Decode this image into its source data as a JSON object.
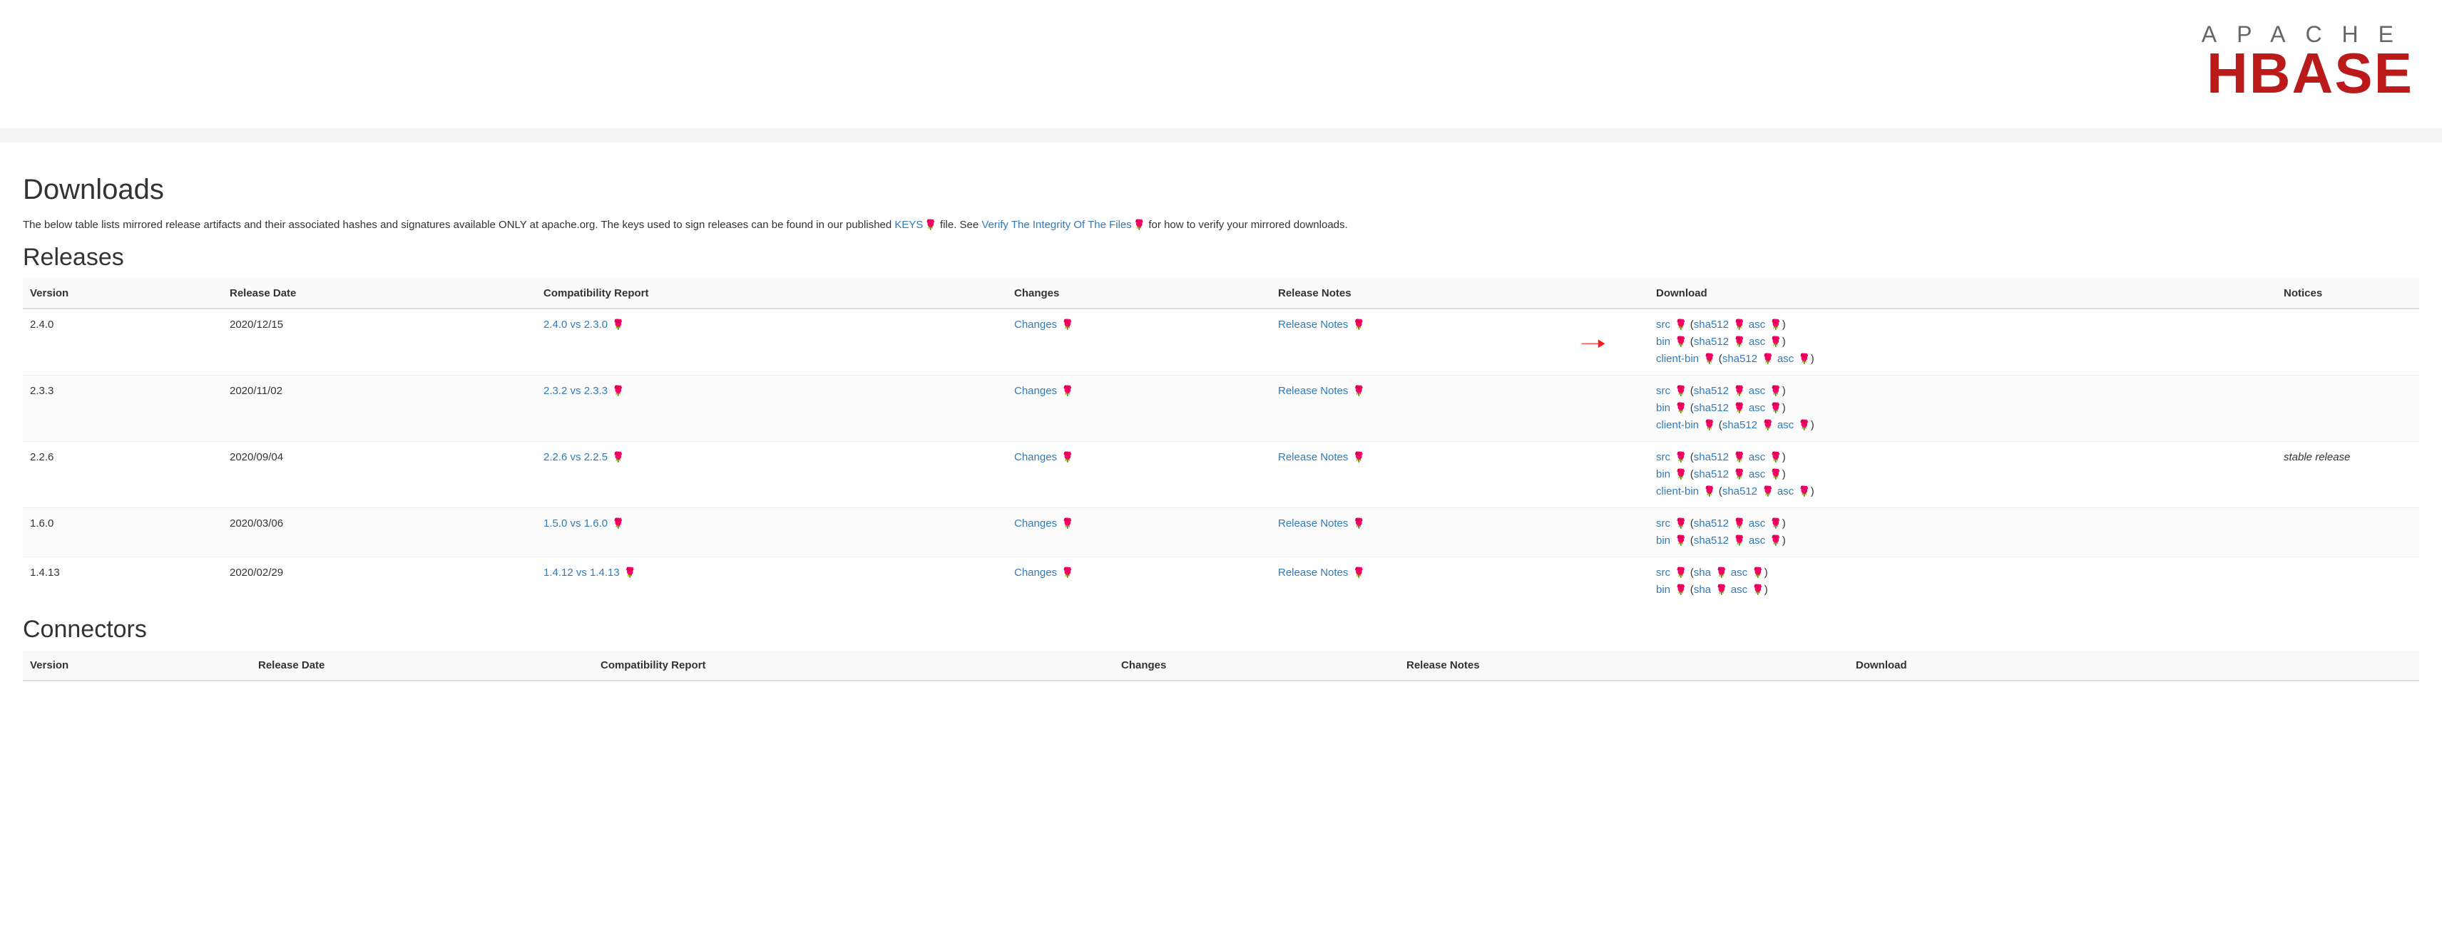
{
  "logo": {
    "apache": "APACHE",
    "hbase": "HBASE"
  },
  "page": {
    "title": "Downloads",
    "intro_prefix": "The below table lists mirrored release artifacts and their associated hashes and signatures available ONLY at apache.org. The keys used to sign releases can be found in our published ",
    "keys_link": "KEYS",
    "intro_mid": " file. See ",
    "verify_link": "Verify The Integrity Of The Files",
    "intro_suffix": " for how to verify your mirrored downloads."
  },
  "sections": {
    "releases": "Releases",
    "connectors": "Connectors"
  },
  "headers": {
    "version": "Version",
    "release_date": "Release Date",
    "compat": "Compatibility Report",
    "changes": "Changes",
    "notes": "Release Notes",
    "download": "Download",
    "notices": "Notices"
  },
  "labels": {
    "changes": "Changes",
    "notes": "Release Notes",
    "src": "src",
    "bin": "bin",
    "client_bin": "client-bin",
    "sha512": "sha512",
    "sha": "sha",
    "asc": "asc",
    "stable": "stable release"
  },
  "releases": [
    {
      "version": "2.4.0",
      "date": "2020/12/15",
      "compat": "2.4.0 vs 2.3.0",
      "downloads": [
        {
          "kind": "src",
          "hash": "sha512"
        },
        {
          "kind": "bin",
          "hash": "sha512"
        },
        {
          "kind": "client_bin",
          "hash": "sha512"
        }
      ],
      "notice": "",
      "arrow_on": 1
    },
    {
      "version": "2.3.3",
      "date": "2020/11/02",
      "compat": "2.3.2 vs 2.3.3",
      "downloads": [
        {
          "kind": "src",
          "hash": "sha512"
        },
        {
          "kind": "bin",
          "hash": "sha512"
        },
        {
          "kind": "client_bin",
          "hash": "sha512"
        }
      ],
      "notice": ""
    },
    {
      "version": "2.2.6",
      "date": "2020/09/04",
      "compat": "2.2.6 vs 2.2.5",
      "downloads": [
        {
          "kind": "src",
          "hash": "sha512"
        },
        {
          "kind": "bin",
          "hash": "sha512"
        },
        {
          "kind": "client_bin",
          "hash": "sha512"
        }
      ],
      "notice": "stable release"
    },
    {
      "version": "1.6.0",
      "date": "2020/03/06",
      "compat": "1.5.0 vs 1.6.0",
      "downloads": [
        {
          "kind": "src",
          "hash": "sha512"
        },
        {
          "kind": "bin",
          "hash": "sha512"
        }
      ],
      "notice": ""
    },
    {
      "version": "1.4.13",
      "date": "2020/02/29",
      "compat": "1.4.12 vs 1.4.13",
      "downloads": [
        {
          "kind": "src",
          "hash": "sha"
        },
        {
          "kind": "bin",
          "hash": "sha"
        }
      ],
      "notice": ""
    }
  ]
}
